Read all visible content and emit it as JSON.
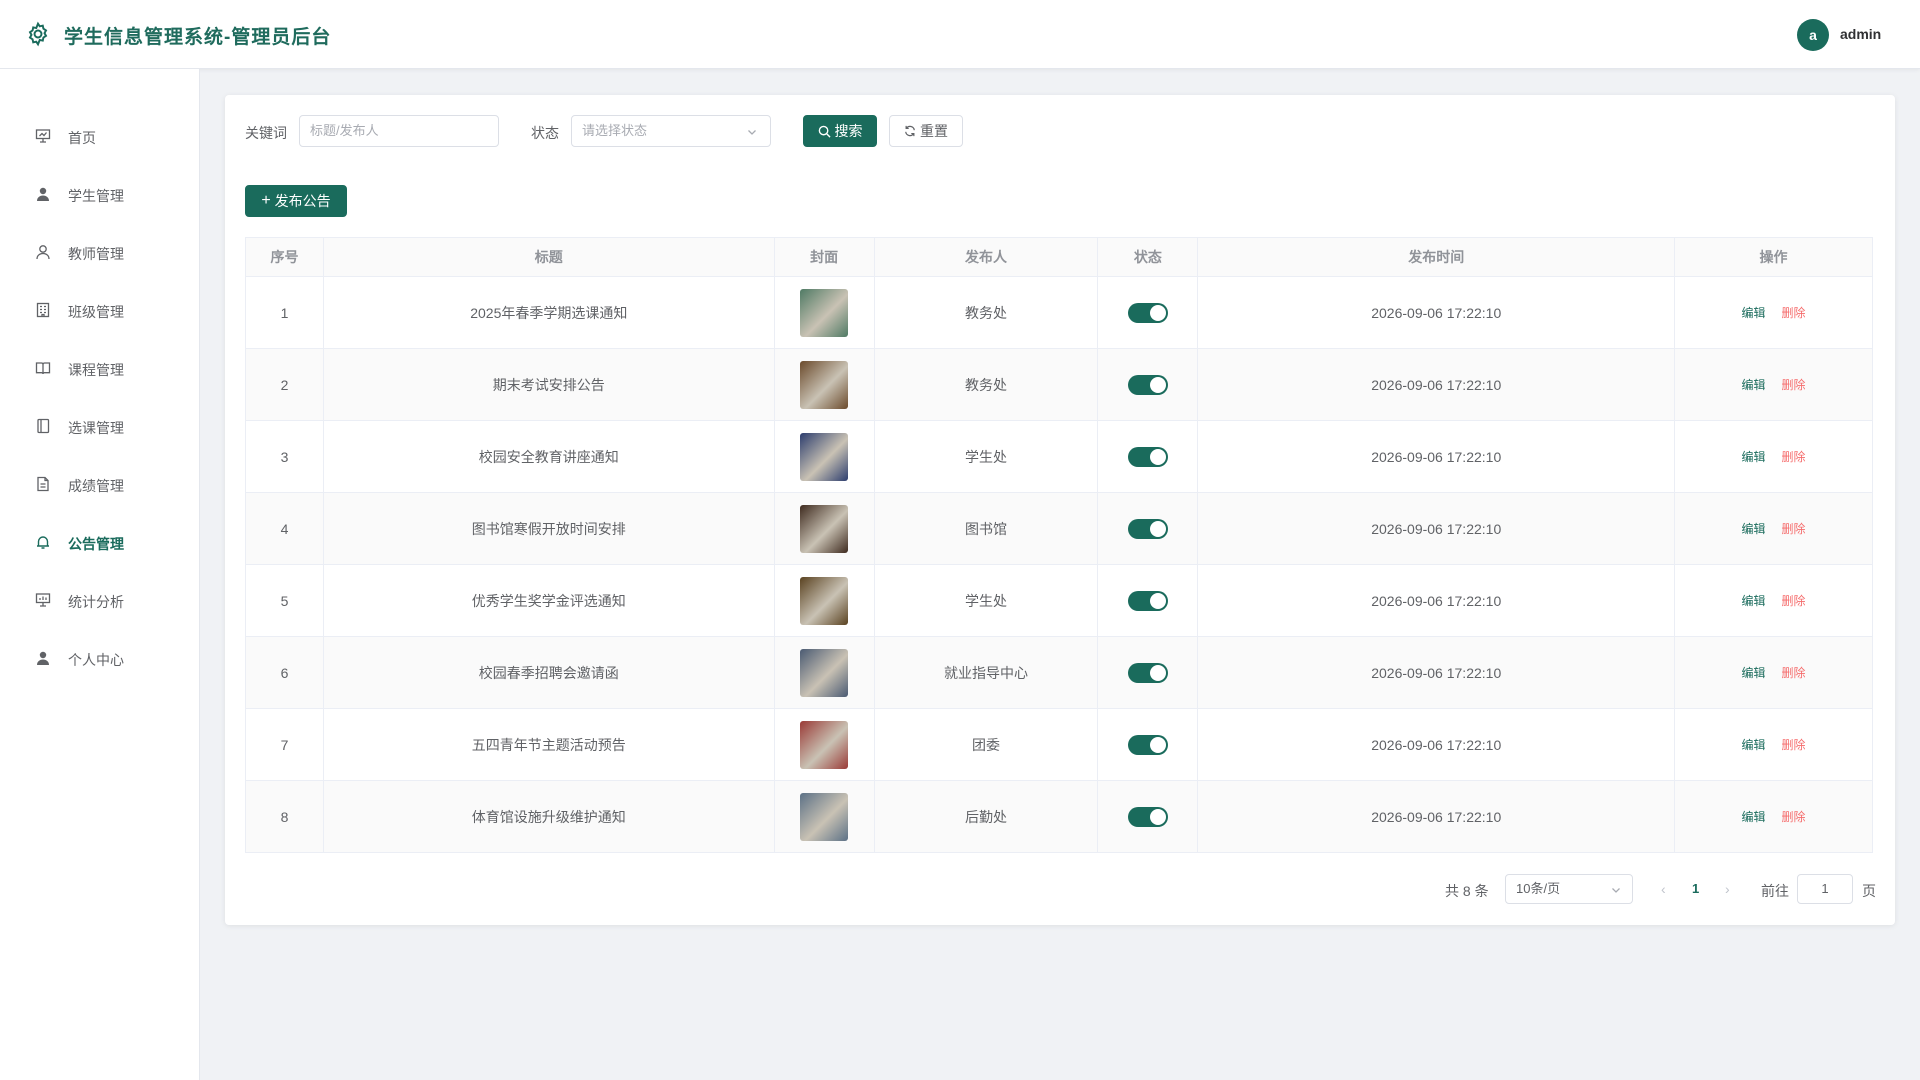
{
  "header": {
    "title": "学生信息管理系统-管理员后台",
    "avatar_letter": "a",
    "username": "admin"
  },
  "sidebar": {
    "items": [
      {
        "label": "首页",
        "icon": "presentation-icon",
        "active": false
      },
      {
        "label": "学生管理",
        "icon": "user-filled-icon",
        "active": false
      },
      {
        "label": "教师管理",
        "icon": "user-icon",
        "active": false
      },
      {
        "label": "班级管理",
        "icon": "building-icon",
        "active": false
      },
      {
        "label": "课程管理",
        "icon": "book-open-icon",
        "active": false
      },
      {
        "label": "选课管理",
        "icon": "notebook-icon",
        "active": false
      },
      {
        "label": "成绩管理",
        "icon": "document-icon",
        "active": false
      },
      {
        "label": "公告管理",
        "icon": "bell-icon",
        "active": true
      },
      {
        "label": "统计分析",
        "icon": "chart-board-icon",
        "active": false
      },
      {
        "label": "个人中心",
        "icon": "user-filled-icon",
        "active": false
      }
    ]
  },
  "filters": {
    "keyword_label": "关键词",
    "keyword_placeholder": "标题/发布人",
    "status_label": "状态",
    "status_placeholder": "请选择状态",
    "search_label": "搜索",
    "reset_label": "重置"
  },
  "publish_label": "发布公告",
  "table": {
    "columns": [
      "序号",
      "标题",
      "封面",
      "发布人",
      "状态",
      "发布时间",
      "操作"
    ],
    "edit_label": "编辑",
    "delete_label": "删除",
    "rows": [
      {
        "index": "1",
        "title": "2025年春季学期选课通知",
        "publisher": "教务处",
        "status": true,
        "time": "2026-09-06 17:22:10",
        "cover": "#4f7a64"
      },
      {
        "index": "2",
        "title": "期末考试安排公告",
        "publisher": "教务处",
        "status": true,
        "time": "2026-09-06 17:22:10",
        "cover": "#6b4a2b"
      },
      {
        "index": "3",
        "title": "校园安全教育讲座通知",
        "publisher": "学生处",
        "status": true,
        "time": "2026-09-06 17:22:10",
        "cover": "#2c3d6e"
      },
      {
        "index": "4",
        "title": "图书馆寒假开放时间安排",
        "publisher": "图书馆",
        "status": true,
        "time": "2026-09-06 17:22:10",
        "cover": "#3e2a1e"
      },
      {
        "index": "5",
        "title": "优秀学生奖学金评选通知",
        "publisher": "学生处",
        "status": true,
        "time": "2026-09-06 17:22:10",
        "cover": "#5a4220"
      },
      {
        "index": "6",
        "title": "校园春季招聘会邀请函",
        "publisher": "就业指导中心",
        "status": true,
        "time": "2026-09-06 17:22:10",
        "cover": "#4a5a72"
      },
      {
        "index": "7",
        "title": "五四青年节主题活动预告",
        "publisher": "团委",
        "status": true,
        "time": "2026-09-06 17:22:10",
        "cover": "#9a3a36"
      },
      {
        "index": "8",
        "title": "体育馆设施升级维护通知",
        "publisher": "后勤处",
        "status": true,
        "time": "2026-09-06 17:22:10",
        "cover": "#5c7186"
      }
    ]
  },
  "pagination": {
    "total_text": "共 8 条",
    "page_size": "10条/页",
    "current_page": "1",
    "goto_label": "前往",
    "goto_value": "1",
    "page_unit": "页"
  },
  "colors": {
    "primary": "#1a6b5c",
    "danger": "#f56c6c"
  }
}
